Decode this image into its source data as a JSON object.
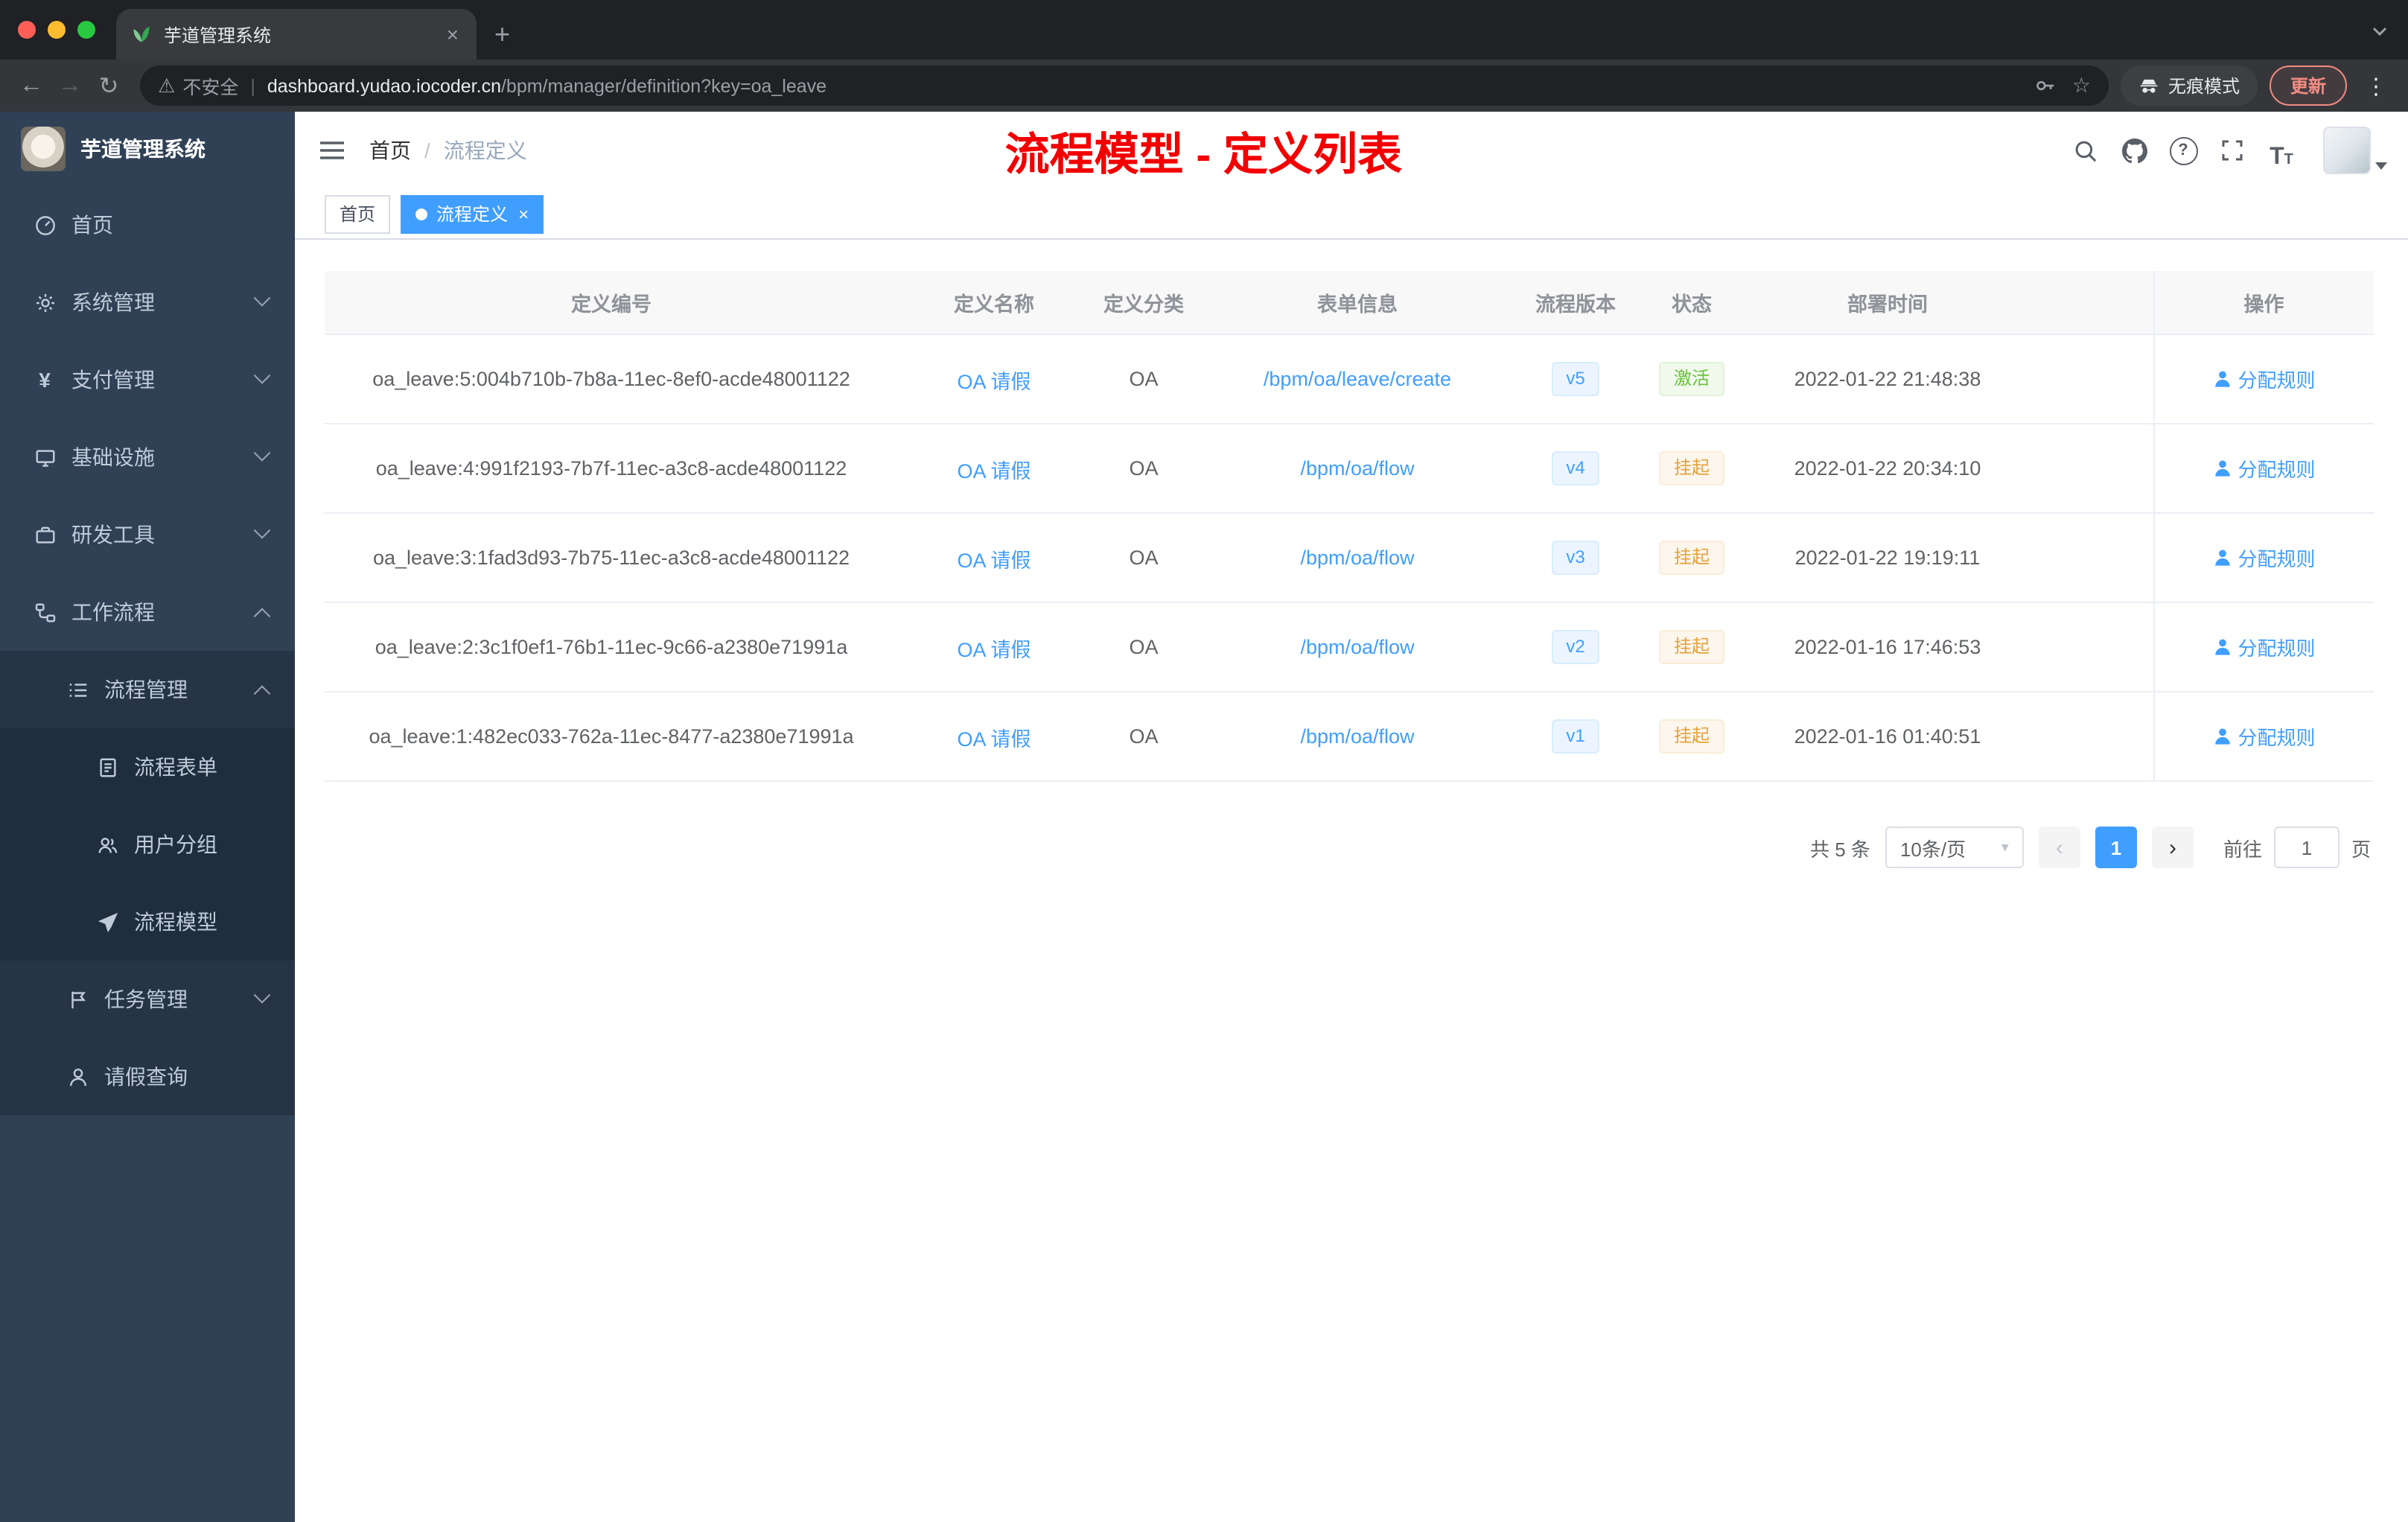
{
  "colors": {
    "accent": "#409eff",
    "annotation_red": "#f20000",
    "status_active": "#67c23a",
    "status_suspended": "#e6a23c",
    "sidebar_bg": "#304156"
  },
  "icons": {
    "back": "←",
    "forward": "→",
    "reload": "↻",
    "warning": "⚠",
    "star": "☆",
    "menu_dots": "⋮",
    "new_tab": "+",
    "close": "×",
    "prev": "‹",
    "next": "›",
    "caret_down": "▾",
    "question": "?",
    "yen": "¥",
    "font_large": "T",
    "font_small": "T"
  },
  "browser": {
    "tab_title": "芋道管理系统",
    "security_label": "不安全",
    "url_host": "dashboard.yudao.iocoder.cn",
    "url_path": "/bpm/manager/definition?key=oa_leave",
    "incognito_label": "无痕模式",
    "update_label": "更新"
  },
  "sidebar": {
    "title": "芋道管理系统",
    "items": [
      {
        "label": "首页"
      },
      {
        "label": "系统管理"
      },
      {
        "label": "支付管理"
      },
      {
        "label": "基础设施"
      },
      {
        "label": "研发工具"
      },
      {
        "label": "工作流程"
      },
      {
        "label": "流程管理"
      },
      {
        "label": "流程表单"
      },
      {
        "label": "用户分组"
      },
      {
        "label": "流程模型"
      },
      {
        "label": "任务管理"
      },
      {
        "label": "请假查询"
      }
    ]
  },
  "header": {
    "breadcrumb": [
      "首页",
      "流程定义"
    ],
    "breadcrumb_sep": "/",
    "annotation": "流程模型 - 定义列表"
  },
  "tags": [
    {
      "label": "首页"
    },
    {
      "label": "流程定义"
    }
  ],
  "table": {
    "columns": [
      "定义编号",
      "定义名称",
      "定义分类",
      "表单信息",
      "流程版本",
      "状态",
      "部署时间",
      "操作"
    ],
    "action_label": "分配规则",
    "rows": [
      {
        "id": "oa_leave:5:004b710b-7b8a-11ec-8ef0-acde48001122",
        "name": "OA 请假",
        "category": "OA",
        "form": "/bpm/oa/leave/create",
        "version": "v5",
        "status": "激活",
        "time": "2022-01-22 21:48:38"
      },
      {
        "id": "oa_leave:4:991f2193-7b7f-11ec-a3c8-acde48001122",
        "name": "OA 请假",
        "category": "OA",
        "form": "/bpm/oa/flow",
        "version": "v4",
        "status": "挂起",
        "time": "2022-01-22 20:34:10"
      },
      {
        "id": "oa_leave:3:1fad3d93-7b75-11ec-a3c8-acde48001122",
        "name": "OA 请假",
        "category": "OA",
        "form": "/bpm/oa/flow",
        "version": "v3",
        "status": "挂起",
        "time": "2022-01-22 19:19:11"
      },
      {
        "id": "oa_leave:2:3c1f0ef1-76b1-11ec-9c66-a2380e71991a",
        "name": "OA 请假",
        "category": "OA",
        "form": "/bpm/oa/flow",
        "version": "v2",
        "status": "挂起",
        "time": "2022-01-16 17:46:53"
      },
      {
        "id": "oa_leave:1:482ec033-762a-11ec-8477-a2380e71991a",
        "name": "OA 请假",
        "category": "OA",
        "form": "/bpm/oa/flow",
        "version": "v1",
        "status": "挂起",
        "time": "2022-01-16 01:40:51"
      }
    ]
  },
  "pagination": {
    "total": "共 5 条",
    "page_size": "10条/页",
    "current_page": "1",
    "goto_label": "前往",
    "goto_value": "1",
    "page_unit": "页"
  }
}
